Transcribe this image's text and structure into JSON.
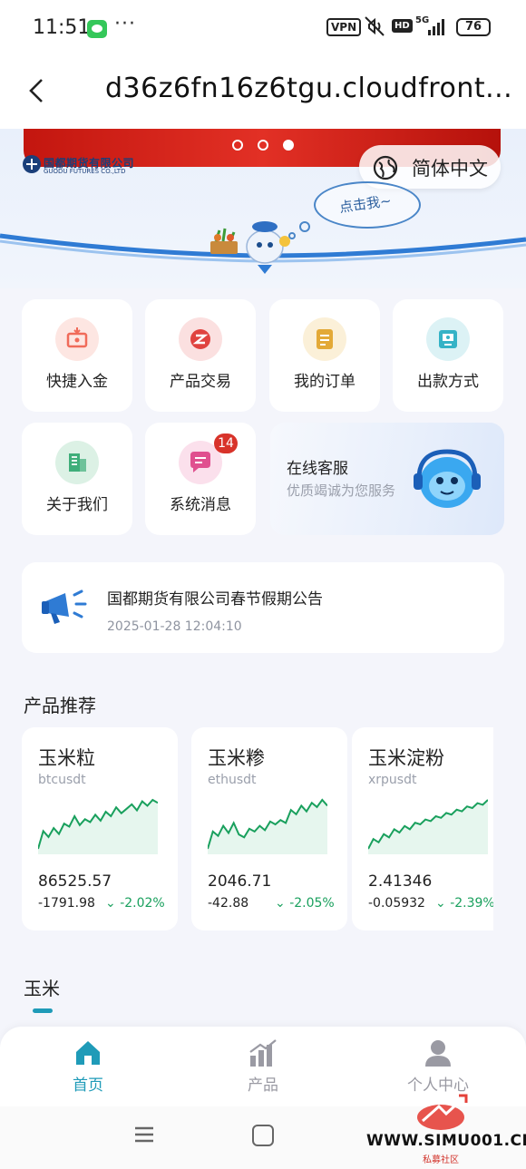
{
  "status_bar": {
    "time": "11:51",
    "more": "···",
    "vpn": "VPN",
    "hd": "HD",
    "network": "5G",
    "battery": "76"
  },
  "header": {
    "url": "d36z6fn16z6tgu.cloudfront..."
  },
  "banner": {
    "logo_cn": "国都期货有限公司",
    "logo_en": "GUODU FUTURES CO.,LTD",
    "language": "简体中文",
    "bubble": "点击我~",
    "carousel_active": 3,
    "carousel_count": 3
  },
  "menu": [
    {
      "label": "快捷入金",
      "icon": "wallet-deposit-icon",
      "color": "#f06b5a"
    },
    {
      "label": "产品交易",
      "icon": "trade-icon",
      "color": "#e0433f"
    },
    {
      "label": "我的订单",
      "icon": "order-list-icon",
      "color": "#e3a937"
    },
    {
      "label": "出款方式",
      "icon": "withdraw-icon",
      "color": "#35b3c6"
    },
    {
      "label": "关于我们",
      "icon": "building-icon",
      "color": "#3fae7a"
    },
    {
      "label": "系统消息",
      "icon": "message-icon",
      "color": "#e0508f",
      "badge": "14"
    }
  ],
  "service": {
    "title": "在线客服",
    "subtitle": "优质竭诚为您服务"
  },
  "notice": {
    "title": "国都期货有限公司春节假期公告",
    "time": "2025-01-28 12:04:10"
  },
  "products": {
    "section_title": "产品推荐",
    "items": [
      {
        "name": "玉米粒",
        "symbol": "btcusdt",
        "price": "86525.57",
        "change": "-1791.98",
        "percent": "-2.02%",
        "trend": [
          30,
          42,
          38,
          44,
          40,
          47,
          45,
          52,
          46,
          50,
          48,
          53,
          49,
          55,
          52,
          58,
          54,
          57,
          60,
          56,
          62,
          59,
          63,
          61
        ]
      },
      {
        "name": "玉米糁",
        "symbol": "ethusdt",
        "price": "2046.71",
        "change": "-42.88",
        "percent": "-2.05%",
        "trend": [
          28,
          40,
          37,
          44,
          39,
          46,
          38,
          36,
          42,
          40,
          44,
          41,
          47,
          45,
          48,
          46,
          55,
          52,
          58,
          54,
          60,
          57,
          62,
          58
        ]
      },
      {
        "name": "玉米淀粉",
        "symbol": "xrpusdt",
        "price": "2.41346",
        "change": "-0.05932",
        "percent": "-2.39%",
        "trend": [
          30,
          36,
          34,
          39,
          37,
          42,
          40,
          44,
          42,
          46,
          45,
          48,
          47,
          50,
          49,
          52,
          51,
          54,
          53,
          56,
          55,
          58,
          57,
          60
        ]
      }
    ]
  },
  "category": {
    "title": "玉米"
  },
  "bottom_nav": [
    {
      "label": "首页",
      "icon": "home-icon",
      "active": true
    },
    {
      "label": "产品",
      "icon": "chart-bars-icon",
      "active": false
    },
    {
      "label": "个人中心",
      "icon": "user-icon",
      "active": false
    }
  ],
  "watermark": {
    "text": "WWW.SIMU001.CN",
    "sub": "私募社区"
  },
  "colors": {
    "accent": "#1f9bb8",
    "negative_pct": "#19a05d",
    "badge": "#d8332a",
    "banner_red": "#e23025"
  }
}
